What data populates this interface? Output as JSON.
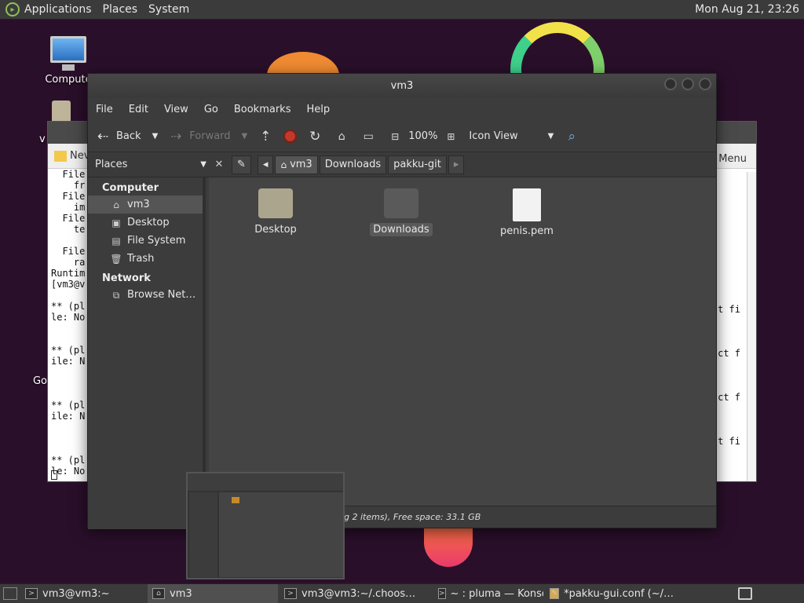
{
  "top_panel": {
    "menus": [
      "Applications",
      "Places",
      "System"
    ],
    "clock": "Mon Aug 21, 23:26"
  },
  "desktop_icons": {
    "computer": "Compute",
    "home_partial": "v",
    "go_partial": "Go"
  },
  "terminal": {
    "tab_label": "Nev",
    "menu_label": "n Menu",
    "lines": [
      "  File",
      "    fr",
      "  File",
      "    im",
      "  File",
      "    te",
      "",
      "  File",
      "    ra",
      "Runtim",
      "[vm3@v",
      "",
      "** (pl",
      "le: No",
      "",
      "",
      "** (pl",
      "ile: N",
      "",
      "",
      "",
      "** (pl",
      "ile: N",
      "",
      "",
      "",
      "** (pl",
      "le: No"
    ],
    "right_texts": [
      "t fi",
      "ct f",
      "ct f",
      "t fi"
    ]
  },
  "file_manager": {
    "title": "vm3",
    "menus": [
      "File",
      "Edit",
      "View",
      "Go",
      "Bookmarks",
      "Help"
    ],
    "toolbar": {
      "back": "Back",
      "forward": "Forward",
      "zoom": "100%",
      "view_mode": "Icon View"
    },
    "places_label": "Places",
    "breadcrumbs": [
      "vm3",
      "Downloads",
      "pakku-git"
    ],
    "sidebar": {
      "computer_header": "Computer",
      "computer_items": [
        "vm3",
        "Desktop",
        "File System",
        "Trash"
      ],
      "network_header": "Network",
      "network_items": [
        "Browse Net…"
      ]
    },
    "files": [
      "Desktop",
      "Downloads",
      "penis.pem"
    ],
    "status": "g 2 items), Free space: 33.1 GB"
  },
  "taskbar": {
    "tasks": [
      "vm3@vm3:~",
      "vm3",
      "vm3@vm3:~/.choos…",
      "~ : pluma — Konsole",
      "*pakku-gui.conf (~/…"
    ]
  },
  "colors": {
    "panel_bg": "#3b3b3b",
    "window_bg": "#3c3c3c",
    "content_bg": "#444444",
    "desktop_bg": "#2a0f2a"
  }
}
